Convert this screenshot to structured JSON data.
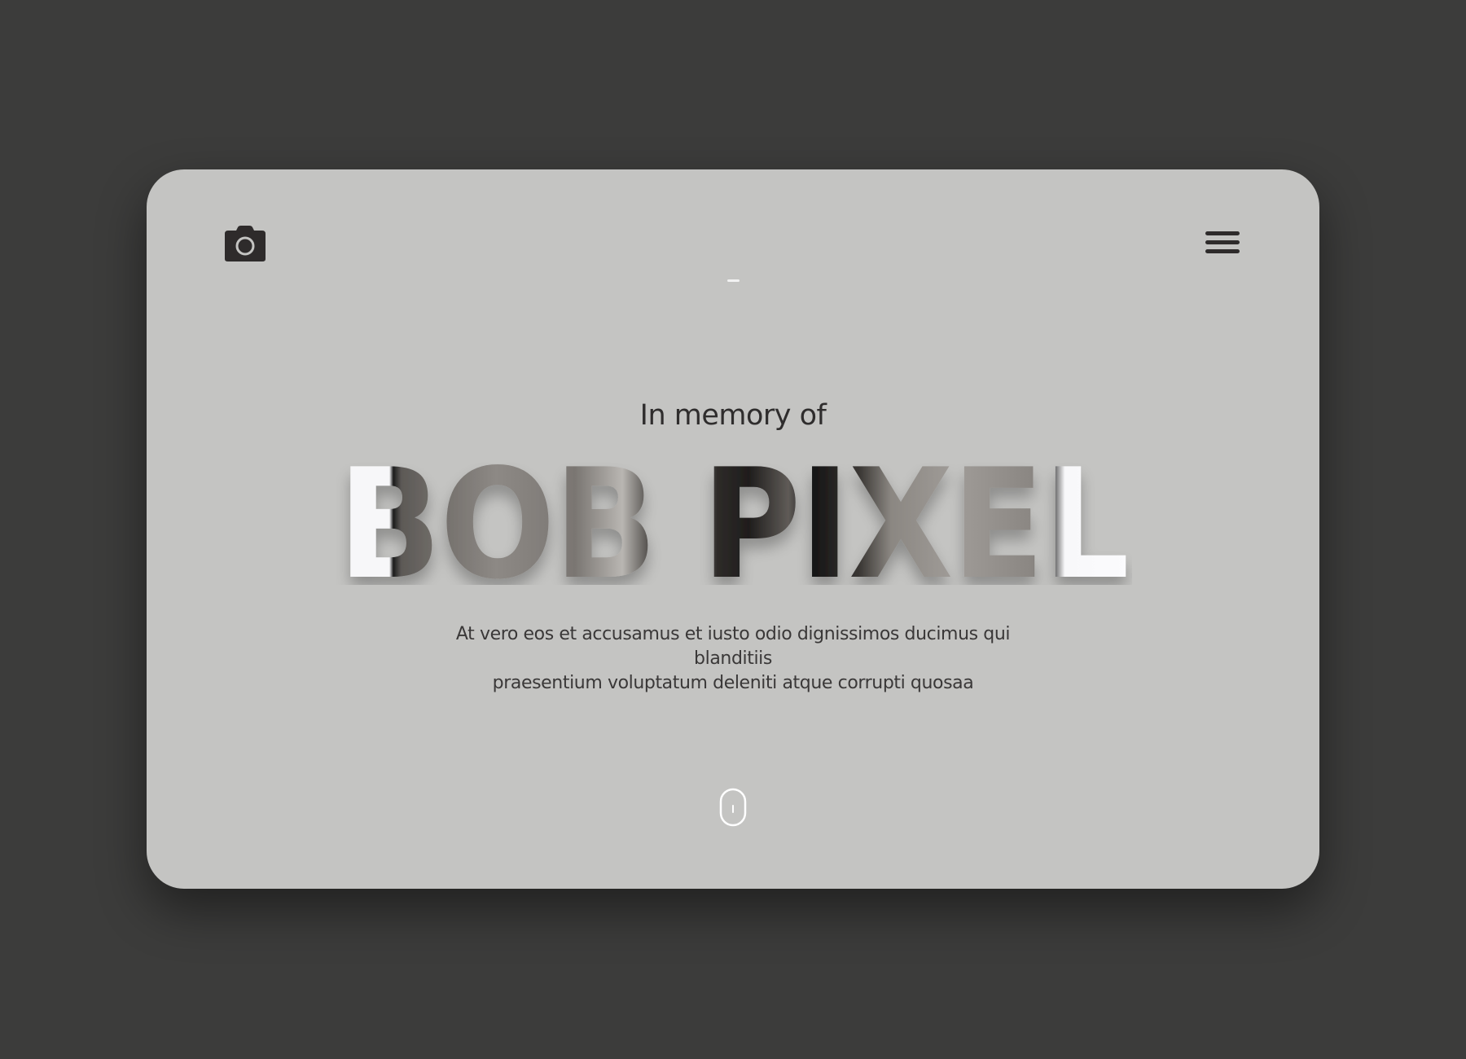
{
  "header": {
    "logo_icon": "camera-icon",
    "menu_icon": "hamburger-menu-icon"
  },
  "hero": {
    "eyebrow": "In memory of",
    "name": "BOB PIXEL",
    "description_line1": "At vero eos et accusamus et iusto odio dignissimos ducimus qui blanditiis",
    "description_line2": "praesentium voluptatum deleniti atque corrupti quosaa"
  },
  "scroll_indicator": {
    "icon": "mouse-scroll-icon"
  },
  "colors": {
    "page_background": "#3c3c3b",
    "card_background": "#c4c4c2",
    "text_dark": "#2f2d2d"
  }
}
